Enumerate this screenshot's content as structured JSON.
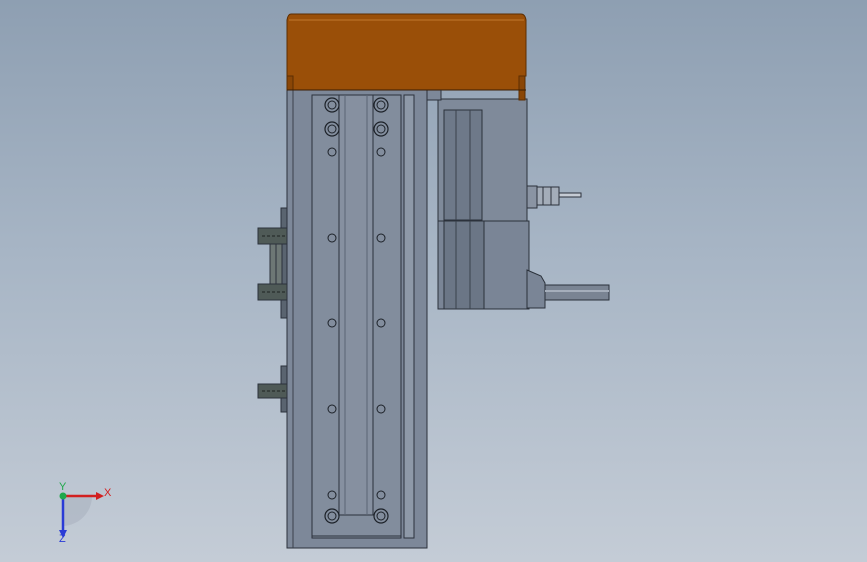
{
  "viewport": {
    "background_top": "#8e9fb2",
    "background_bottom": "#c4ccd6"
  },
  "model": {
    "colors": {
      "cover": "#9a4f08",
      "cover_edge": "#6b3604",
      "body": "#7d8899",
      "body_light": "#9aa4b3",
      "body_dark": "#5a6373",
      "outline": "#2b313b",
      "bracket": "#4f5a57",
      "shaft": "#7a8493"
    }
  },
  "triad": {
    "x_label": "X",
    "y_label": "Y",
    "z_label": "Z",
    "x_color": "#d22020",
    "y_color": "#1fa84a",
    "z_color": "#2a3bd6"
  }
}
